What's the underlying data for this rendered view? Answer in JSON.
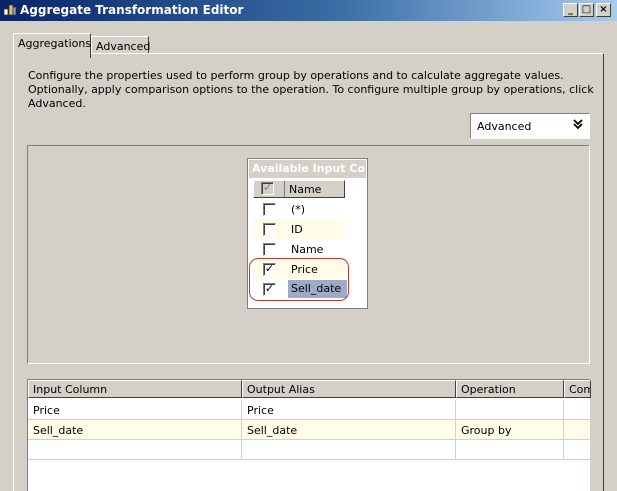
{
  "window": {
    "title": "Aggregate Transformation Editor",
    "minimize": "_",
    "maximize": "□",
    "close": "×"
  },
  "tabs": [
    {
      "label": "Aggregations",
      "active": true
    },
    {
      "label": "Advanced",
      "active": false
    }
  ],
  "description": "Configure the properties used to perform group by operations and to calculate aggregate values. Optionally, apply comparison options to the operation. To configure multiple group by operations, click Advanced.",
  "advanced_toggle": {
    "label": "Advanced",
    "icon": "double-chevron-down-icon"
  },
  "input_columns": {
    "title": "Available Input Co...",
    "header": "Name",
    "rows": [
      {
        "name": "(*)",
        "checked": false
      },
      {
        "name": "ID",
        "checked": false
      },
      {
        "name": "Name",
        "checked": false
      },
      {
        "name": "Price",
        "checked": true
      },
      {
        "name": "Sell_date",
        "checked": true
      }
    ]
  },
  "grid": {
    "columns": [
      "Input Column",
      "Output Alias",
      "Operation",
      "Com"
    ],
    "rows": [
      {
        "input": "Price",
        "alias": "Price",
        "operation": ""
      },
      {
        "input": "Sell_date",
        "alias": "Sell_date",
        "operation": "Group by"
      }
    ]
  },
  "colors": {
    "title_gradient_start": "#0a246a",
    "title_gradient_end": "#a6caf0",
    "face": "#d4d0c8",
    "highlight_row": "#fffde9",
    "callout": "#c0392b"
  }
}
